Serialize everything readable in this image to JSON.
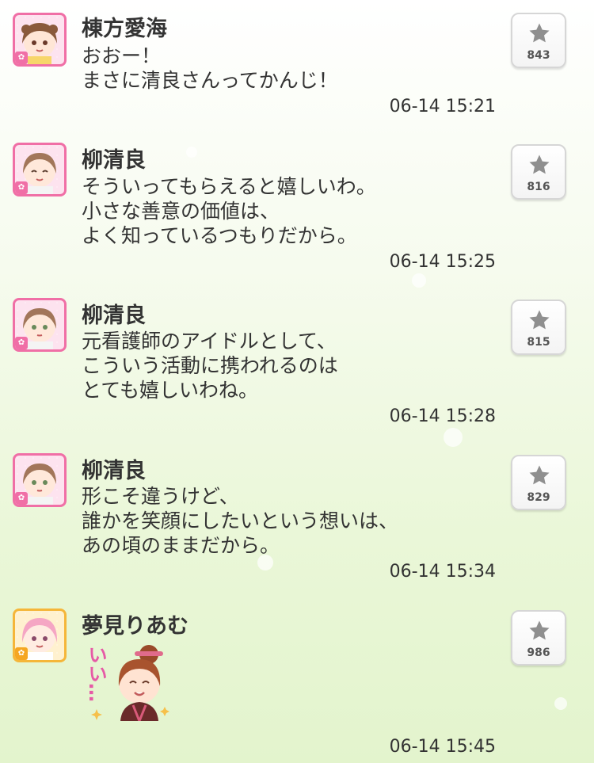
{
  "posts": [
    {
      "author": "棟方愛海",
      "avatar_icon": "girl-avatar-icon",
      "lines": [
        "おおー！",
        "まさに清良さんってかんじ！"
      ],
      "time": "06-14 15:21",
      "likes": "843"
    },
    {
      "author": "柳清良",
      "avatar_icon": "nurse-avatar-icon",
      "lines": [
        "そういってもらえると嬉しいわ。",
        "小さな善意の価値は、",
        "よく知っているつもりだから。"
      ],
      "time": "06-14 15:25",
      "likes": "816"
    },
    {
      "author": "柳清良",
      "avatar_icon": "nurse-avatar-icon",
      "lines": [
        "元看護師のアイドルとして、",
        "こういう活動に携われるのは",
        "とても嬉しいわね。"
      ],
      "time": "06-14 15:28",
      "likes": "815"
    },
    {
      "author": "柳清良",
      "avatar_icon": "nurse-avatar-icon",
      "lines": [
        "形こそ違うけど、",
        "誰かを笑顔にしたいという想いは、",
        "あの頃のままだから。"
      ],
      "time": "06-14 15:34",
      "likes": "829"
    },
    {
      "author": "夢見りあむ",
      "avatar_icon": "pink-hair-avatar-icon",
      "stamp_text": "いい…",
      "stamp_icon": "smiling-girl-stamp-icon",
      "time": "06-14 15:45",
      "likes": "986"
    }
  ],
  "icons": {
    "like": "star-icon",
    "badge": "flower-badge-icon"
  },
  "colors": {
    "avatar_border_pink": "#f06fa6",
    "avatar_border_yellow": "#f5b63a",
    "stamp_text": "#e65aa6"
  }
}
